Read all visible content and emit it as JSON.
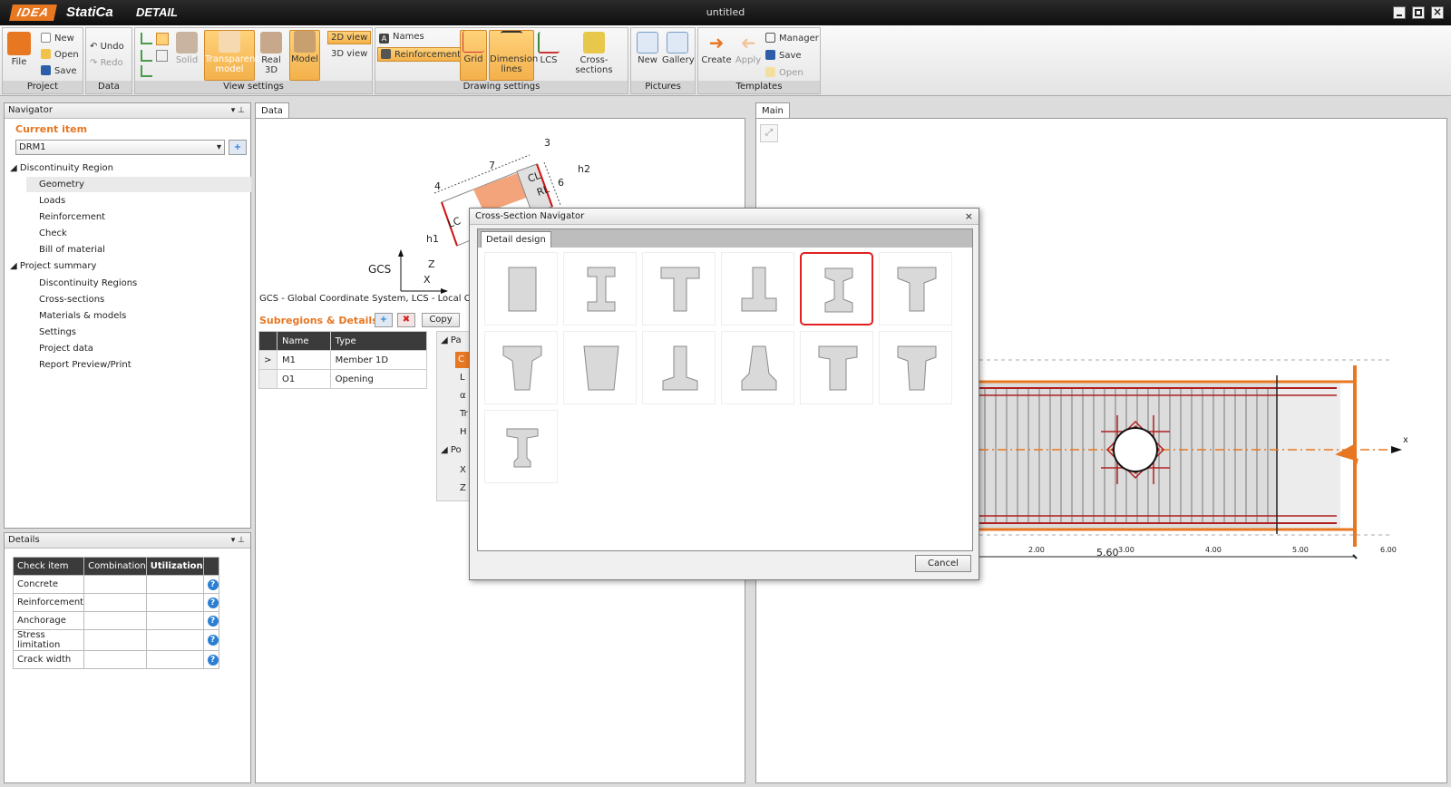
{
  "app": {
    "logo_text": "IDEA",
    "brand": "StatiCa",
    "product": "DETAIL",
    "document_title": "untitled"
  },
  "ribbon": {
    "project": {
      "label": "Project",
      "file": "File",
      "new": "New",
      "open": "Open",
      "save": "Save"
    },
    "data": {
      "label": "Data",
      "undo": "Undo",
      "redo": "Redo"
    },
    "view_settings": {
      "label": "View settings",
      "solid": "Solid",
      "transparent_model": "Transparent model",
      "real3d": "Real 3D",
      "model": "Model",
      "view2d": "2D view",
      "view3d": "3D view"
    },
    "drawing_settings": {
      "label": "Drawing settings",
      "names": "Names",
      "reinforcement": "Reinforcement",
      "grid": "Grid",
      "dimension_lines": "Dimension lines",
      "lcs": "LCS",
      "cross_sections": "Cross-sections"
    },
    "pictures": {
      "label": "Pictures",
      "new": "New",
      "gallery": "Gallery"
    },
    "templates": {
      "label": "Templates",
      "create": "Create",
      "apply": "Apply",
      "manager": "Manager",
      "save": "Save",
      "open": "Open"
    }
  },
  "navigator": {
    "title": "Navigator",
    "current_item_label": "Current item",
    "current_item_value": "DRM1",
    "tree": {
      "discontinuity_region": "Discontinuity Region",
      "geometry": "Geometry",
      "loads": "Loads",
      "reinforcement": "Reinforcement",
      "check": "Check",
      "bill_of_material": "Bill of material",
      "project_summary": "Project summary",
      "discontinuity_regions": "Discontinuity Regions",
      "cross_sections": "Cross-sections",
      "materials_models": "Materials & models",
      "settings": "Settings",
      "project_data": "Project data",
      "report": "Report Preview/Print"
    }
  },
  "details": {
    "title": "Details",
    "columns": [
      "Check item",
      "Combination",
      "Utilization"
    ],
    "rows": [
      "Concrete",
      "Reinforcement",
      "Anchorage",
      "Stress limitation",
      "Crack width"
    ]
  },
  "data_tab": {
    "tab": "Data",
    "sketch": {
      "gcs": "GCS",
      "z": "Z",
      "x": "X",
      "n3": "3",
      "n4": "4",
      "n6": "6",
      "n7": "7",
      "cl": "CL",
      "rl": "RL",
      "lc": "LC",
      "h1": "h1",
      "h2": "h2"
    },
    "caption": "GCS - Global Coordinate System, LCS - Local Coordi",
    "subregions_label": "Subregions & Details",
    "copy": "Copy",
    "grid": {
      "columns": [
        "Name",
        "Type"
      ],
      "rows": [
        {
          "name": "M1",
          "type": "Member 1D",
          "marker": ">"
        },
        {
          "name": "O1",
          "type": "Opening",
          "marker": ""
        }
      ]
    },
    "props": {
      "p1": "Pa",
      "c": "C",
      "l": "L",
      "a": "α",
      "t": "Tr",
      "h": "H",
      "p2": "Po",
      "x": "X",
      "z": "Z"
    }
  },
  "main_tab": {
    "tab": "Main",
    "axis_x": "x",
    "ticks": [
      "2.00",
      "3.00",
      "4.00",
      "5.00",
      "6.00"
    ],
    "dimension": "5.60"
  },
  "dialog": {
    "title": "Cross-Section Navigator",
    "close": "×",
    "tab": "Detail design",
    "cancel": "Cancel",
    "shapes": [
      "rectangle",
      "i-beam",
      "t-beam",
      "inverted-t",
      "i-beam-haunched",
      "t-beam-haunched",
      "tapered-t",
      "trapezoid",
      "inverted-t-tall",
      "inverted-t-haunched",
      "t-beam-wide",
      "t-beam-tapered",
      "i-beam-small"
    ],
    "selected_index": 4
  },
  "colors": {
    "accent": "#e87722",
    "selection": "#e02020",
    "header_dark": "#3b3b3b",
    "rebar": "#b02020"
  }
}
